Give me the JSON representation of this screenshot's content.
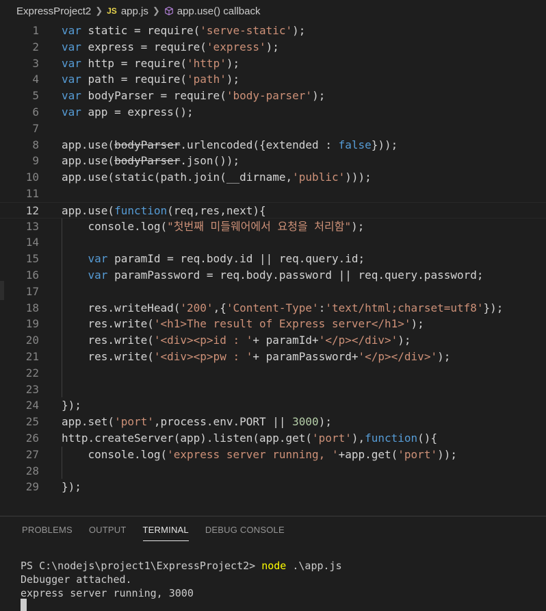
{
  "breadcrumb": {
    "folder": "ExpressProject2",
    "file_badge": "JS",
    "file": "app.js",
    "symbol": "app.use() callback"
  },
  "editor": {
    "current_line": 12,
    "lines": [
      {
        "n": "1",
        "tokens": [
          [
            "kw",
            "var"
          ],
          [
            "",
            "static = require("
          ],
          [
            "str",
            "'serve-static'"
          ],
          [
            "",
            ");"
          ]
        ]
      },
      {
        "n": "2",
        "tokens": [
          [
            "kw",
            "var"
          ],
          [
            "",
            "express = require("
          ],
          [
            "str",
            "'express'"
          ],
          [
            "",
            ");"
          ]
        ]
      },
      {
        "n": "3",
        "tokens": [
          [
            "kw",
            "var"
          ],
          [
            "",
            "http = require("
          ],
          [
            "str",
            "'http'"
          ],
          [
            "",
            ");"
          ]
        ]
      },
      {
        "n": "4",
        "tokens": [
          [
            "kw",
            "var"
          ],
          [
            "",
            "path = require("
          ],
          [
            "str",
            "'path'"
          ],
          [
            "",
            ");"
          ]
        ]
      },
      {
        "n": "5",
        "tokens": [
          [
            "kw",
            "var"
          ],
          [
            "",
            "bodyParser = require("
          ],
          [
            "str",
            "'body-parser'"
          ],
          [
            "",
            ");"
          ]
        ]
      },
      {
        "n": "6",
        "tokens": [
          [
            "kw",
            "var"
          ],
          [
            "",
            "app = express();"
          ]
        ]
      },
      {
        "n": "7",
        "tokens": []
      },
      {
        "n": "8",
        "tokens": [
          [
            "",
            "app.use("
          ],
          [
            "strike",
            "bodyParser"
          ],
          [
            "",
            ".urlencoded({extended : "
          ],
          [
            "kw",
            "false"
          ],
          [
            "",
            "}));"
          ]
        ]
      },
      {
        "n": "9",
        "tokens": [
          [
            "",
            "app.use("
          ],
          [
            "strike",
            "bodyParser"
          ],
          [
            "",
            ".json());"
          ]
        ]
      },
      {
        "n": "10",
        "tokens": [
          [
            "",
            "app.use(static(path.join(__dirname,"
          ],
          [
            "str",
            "'public'"
          ],
          [
            "",
            ")));"
          ]
        ]
      },
      {
        "n": "11",
        "tokens": []
      },
      {
        "n": "12",
        "tokens": [
          [
            "",
            "app.use("
          ],
          [
            "kw",
            "function"
          ],
          [
            "",
            "(req,res,next){"
          ]
        ]
      },
      {
        "n": "13",
        "tokens": [
          [
            "",
            "    console.log("
          ],
          [
            "str",
            "\"첫번째 미들웨어에서 요청을 처리함\""
          ],
          [
            "",
            ");"
          ]
        ]
      },
      {
        "n": "14",
        "tokens": []
      },
      {
        "n": "15",
        "tokens": [
          [
            "",
            "    "
          ],
          [
            "kw",
            "var"
          ],
          [
            "",
            "paramId = req.body.id || req.query.id;"
          ]
        ]
      },
      {
        "n": "16",
        "tokens": [
          [
            "",
            "    "
          ],
          [
            "kw",
            "var"
          ],
          [
            "",
            "paramPassword = req.body.password || req.query.password;"
          ]
        ]
      },
      {
        "n": "17",
        "tokens": []
      },
      {
        "n": "18",
        "tokens": [
          [
            "",
            "    res.writeHead("
          ],
          [
            "str",
            "'200'"
          ],
          [
            "",
            ",{"
          ],
          [
            "str",
            "'Content-Type'"
          ],
          [
            "",
            ":"
          ],
          [
            "str",
            "'text/html;charset=utf8'"
          ],
          [
            "",
            "});"
          ]
        ]
      },
      {
        "n": "19",
        "tokens": [
          [
            "",
            "    res.write("
          ],
          [
            "str",
            "'<h1>The result of Express server</h1>'"
          ],
          [
            "",
            ");"
          ]
        ]
      },
      {
        "n": "20",
        "tokens": [
          [
            "",
            "    res.write("
          ],
          [
            "str",
            "'<div><p>id : '"
          ],
          [
            "",
            "+ paramId+"
          ],
          [
            "str",
            "'</p></div>'"
          ],
          [
            "",
            ");"
          ]
        ]
      },
      {
        "n": "21",
        "tokens": [
          [
            "",
            "    res.write("
          ],
          [
            "str",
            "'<div><p>pw : '"
          ],
          [
            "",
            "+ paramPassword+"
          ],
          [
            "str",
            "'</p></div>'"
          ],
          [
            "",
            ");"
          ]
        ]
      },
      {
        "n": "22",
        "tokens": []
      },
      {
        "n": "23",
        "tokens": []
      },
      {
        "n": "24",
        "tokens": [
          [
            "",
            "});"
          ]
        ]
      },
      {
        "n": "25",
        "tokens": [
          [
            "",
            "app.set("
          ],
          [
            "str",
            "'port'"
          ],
          [
            "",
            ",process.env.PORT || "
          ],
          [
            "num",
            "3000"
          ],
          [
            "",
            ");"
          ]
        ]
      },
      {
        "n": "26",
        "tokens": [
          [
            "",
            "http.createServer(app).listen(app.get("
          ],
          [
            "str",
            "'port'"
          ],
          [
            "",
            "),"
          ],
          [
            "kw",
            "function"
          ],
          [
            "",
            "(){"
          ]
        ]
      },
      {
        "n": "27",
        "tokens": [
          [
            "",
            "    console.log("
          ],
          [
            "str",
            "'express server running, '"
          ],
          [
            "",
            "+app.get("
          ],
          [
            "str",
            "'port'"
          ],
          [
            "",
            "));"
          ]
        ]
      },
      {
        "n": "28",
        "tokens": []
      },
      {
        "n": "29",
        "tokens": [
          [
            "",
            "});"
          ]
        ]
      }
    ]
  },
  "panel": {
    "tabs": [
      {
        "label": "PROBLEMS",
        "active": false
      },
      {
        "label": "OUTPUT",
        "active": false
      },
      {
        "label": "TERMINAL",
        "active": true
      },
      {
        "label": "DEBUG CONSOLE",
        "active": false
      }
    ],
    "terminal": {
      "prompt": "PS C:\\nodejs\\project1\\ExpressProject2> ",
      "command": "node",
      "args": " .\\app.js",
      "output": [
        "Debugger attached.",
        "express server running, 3000"
      ]
    }
  },
  "colors": {
    "keyword": "#569cd6",
    "string": "#ce9178",
    "number": "#b5cea8",
    "command": "#ffff00"
  }
}
